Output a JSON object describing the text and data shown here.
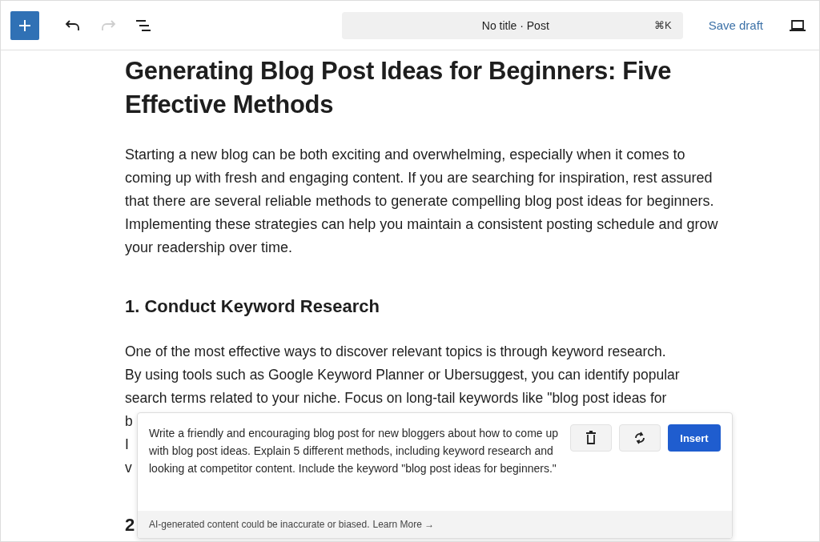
{
  "toolbar": {
    "tools": [
      {
        "kind": "add",
        "disabled": false
      },
      {
        "kind": "undo",
        "disabled": false
      },
      {
        "kind": "redo",
        "disabled": true
      },
      {
        "kind": "outline",
        "disabled": false
      }
    ],
    "command_bar": {
      "title": "No title · Post",
      "shortcut": "⌘K"
    },
    "save_label": "Save draft"
  },
  "post": {
    "title": "Generating Blog Post Ideas for Beginners: Five Effective Methods",
    "intro": "Starting a new blog can be both exciting and overwhelming, especially when it comes to coming up with fresh and engaging content. If you are searching for inspiration, rest assured that there are several reliable methods to generate compelling blog post ideas for beginners. Implementing these strategies can help you maintain a consistent posting schedule and grow your readership over time.",
    "heading": "1. Conduct Keyword Research",
    "body_lines": [
      "One of the most effective ways to discover relevant topics is through keyword research.",
      "By using tools such as Google Keyword Planner or Ubersuggest, you can identify popular",
      "search terms related to your niche. Focus on long-tail keywords like \"blog post ideas for"
    ],
    "covered_line_starts": [
      "b",
      "I",
      "v"
    ],
    "next_heading_start": "2"
  },
  "ai_panel": {
    "prompt": "Write a friendly and encouraging blog post for new bloggers about how to come up with blog post ideas. Explain 5 different methods, including keyword research and looking at competitor content. Include the keyword \"blog post ideas for beginners.\"",
    "insert_label": "Insert",
    "disclaimer": "AI-generated content could be inaccurate or biased.",
    "learn_more": "Learn More →"
  }
}
